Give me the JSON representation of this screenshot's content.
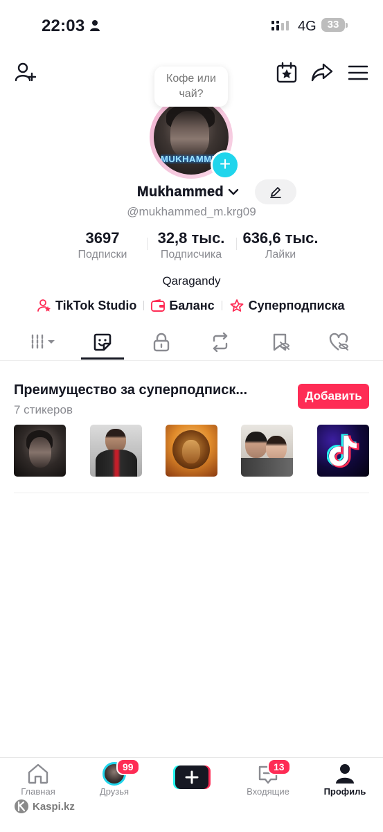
{
  "status_bar": {
    "time": "22:03",
    "network": "4G",
    "battery": "33"
  },
  "profile": {
    "bubble_text": "Кофе или чай?",
    "avatar_text": "MUKHAMMED",
    "display_name": "Mukhammed",
    "handle": "@mukhammed_m.krg09",
    "location": "Qaragandy"
  },
  "stats": [
    {
      "value": "3697",
      "label": "Подписки"
    },
    {
      "value": "32,8 тыс.",
      "label": "Подписчика"
    },
    {
      "value": "636,6 тыс.",
      "label": "Лайки"
    }
  ],
  "links": [
    {
      "label": "TikTok Studio",
      "icon": "studio-icon"
    },
    {
      "label": "Баланс",
      "icon": "wallet-icon"
    },
    {
      "label": "Суперподписка",
      "icon": "super-subscription-icon"
    }
  ],
  "tabs": [
    "videos-grid",
    "stickers",
    "private",
    "reposts",
    "favorites",
    "liked"
  ],
  "stickers_section": {
    "title": "Преимущество за суперподписк...",
    "count": "7 стикеров",
    "add_button": "Добавить"
  },
  "bottom_nav": {
    "home": "Главная",
    "friends": "Друзья",
    "friends_badge": "99",
    "inbox": "Входящие",
    "inbox_badge": "13",
    "profile": "Профиль"
  },
  "watermark": "Kaspi.kz",
  "colors": {
    "accent": "#fe2c55",
    "cyan": "#20d5ec",
    "text": "#161823",
    "muted": "#8a8b91"
  }
}
